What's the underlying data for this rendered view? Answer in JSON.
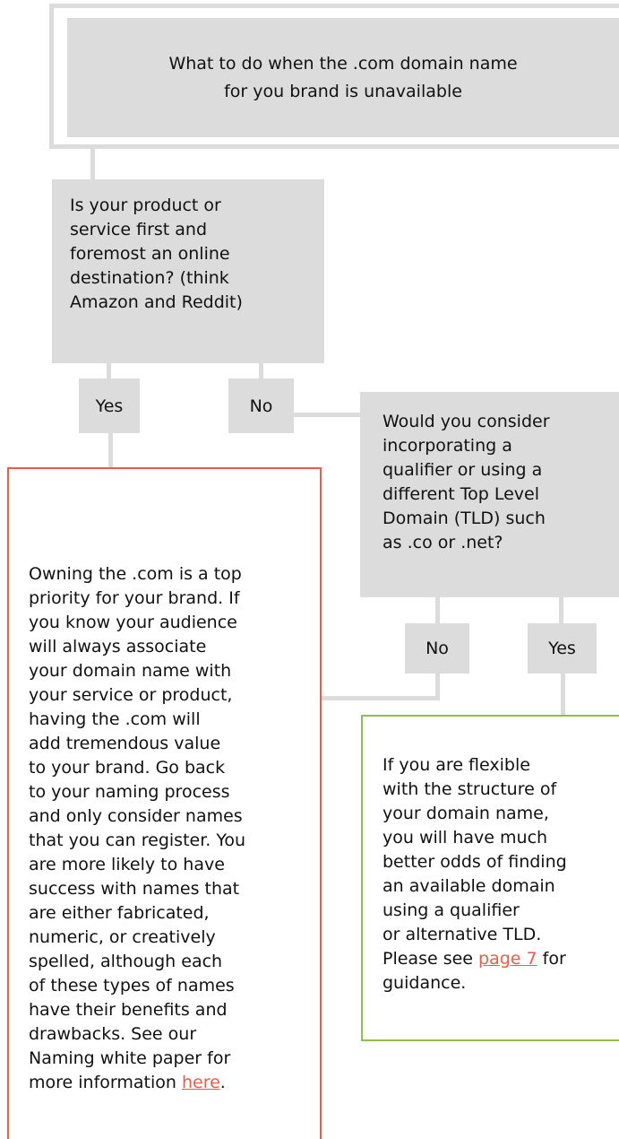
{
  "title": {
    "line1": "What to do when the .com domain name",
    "line2": "for you brand is unavailable"
  },
  "question1": {
    "lines": [
      "Is your product or",
      "service first and",
      "foremost an online",
      "destination? (think",
      "Amazon and Reddit)"
    ]
  },
  "question1_labels": {
    "yes": "Yes",
    "no": "No"
  },
  "question2": {
    "lines": [
      "Would you consider",
      "incorporating a",
      "qualifier or using a",
      "different Top Level",
      "Domain (TLD) such",
      "as .co or .net?"
    ]
  },
  "question2_labels": {
    "no": "No",
    "yes": "Yes"
  },
  "answer_owning": {
    "lines": [
      "Owning the .com is a top",
      "priority for your brand. If",
      "you know  your audience",
      "will always associate",
      "your domain name with",
      "your service or product,",
      "having the .com will",
      "add tremendous value",
      "to your brand. Go back",
      "to your naming process",
      "and only consider names",
      "that you can register. You",
      "are more likely to have",
      "success with names that",
      "are either fabricated,",
      "numeric, or creatively",
      "spelled, although each",
      "of these types of names",
      "have their benefits and",
      "drawbacks. See our",
      "Naming white paper for"
    ],
    "last_line_prefix": "more information ",
    "link_text": "here",
    "last_line_suffix": "."
  },
  "answer_flexible": {
    "lines": [
      "If you are flexible",
      "with the structure of",
      "your domain name,",
      "you will have much",
      "better odds of finding",
      "an available domain",
      "using a qualifier",
      "or alternative TLD."
    ],
    "last_prefix": "Please see ",
    "link_text": "page 7",
    "last_suffix": " for",
    "final_line": "guidance."
  },
  "colors": {
    "box_gray": "#dcdcdc",
    "accent_red": "#ee5c48",
    "accent_green": "#8fbf4a"
  }
}
